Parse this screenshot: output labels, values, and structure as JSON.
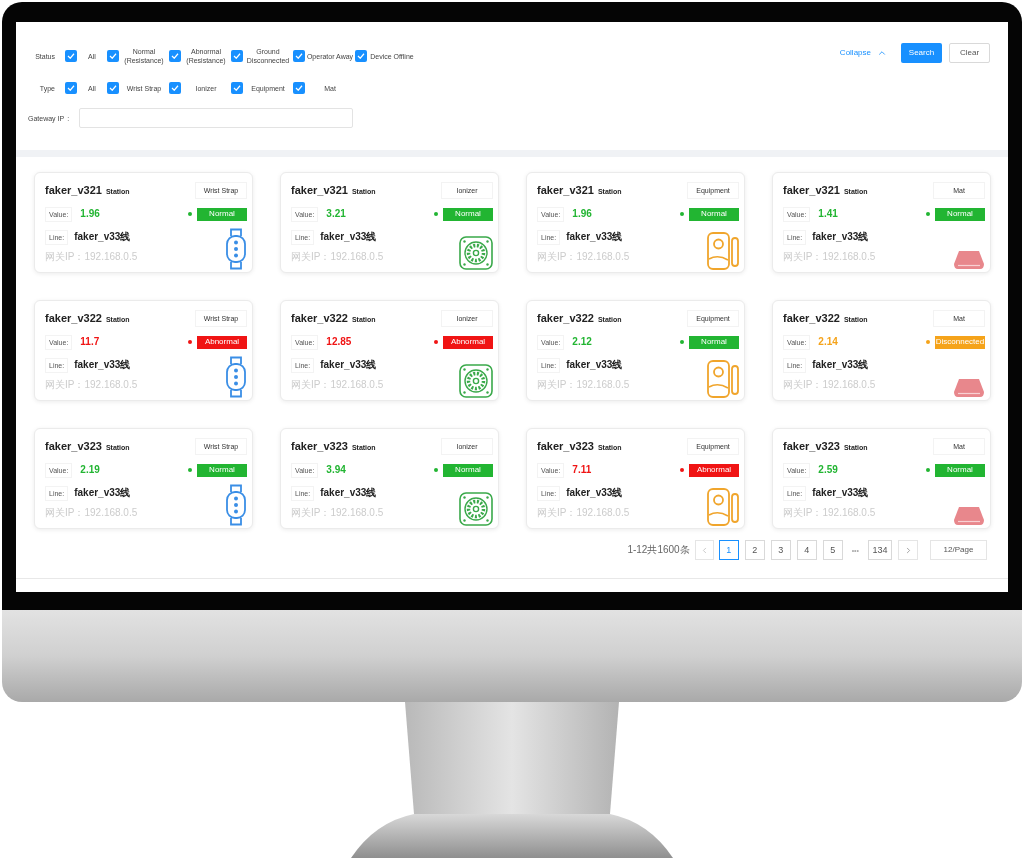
{
  "filters": [
    {
      "label": "Status",
      "options": [
        {
          "label": "All",
          "checked": true
        },
        {
          "label": "Normal (Resistance)",
          "checked": true
        },
        {
          "label": "Abnormal (Resistance)",
          "checked": true
        },
        {
          "label": "Ground Disconnected",
          "checked": true
        },
        {
          "label": "Operator Away",
          "checked": true
        },
        {
          "label": "Device Offline",
          "checked": true
        }
      ]
    },
    {
      "label": "Type",
      "options": [
        {
          "label": "All",
          "checked": true
        },
        {
          "label": "Wrist Strap",
          "checked": true
        },
        {
          "label": "Ionizer",
          "checked": true
        },
        {
          "label": "Equipment",
          "checked": true
        },
        {
          "label": "Mat",
          "checked": true
        }
      ]
    }
  ],
  "gateway_ip": {
    "label": "Gateway IP",
    "separator": ":"
  },
  "collapse": {
    "label": "Collapse"
  },
  "buttons": [
    {
      "label": "Search",
      "kind": "primary"
    },
    {
      "label": "Clear",
      "kind": "default"
    }
  ],
  "cards": [
    {
      "name": "faker_v321",
      "suffix": "Station",
      "device": {
        "label": "Wrist Strap",
        "kind": "wrist_strap"
      },
      "value_label": "Value:",
      "value": "1.96",
      "status": {
        "label": "Normal",
        "color": "#22b532"
      },
      "line_label": "Line:",
      "line": "faker_v33线",
      "gateway_ip": "网关IP：192.168.0.5"
    },
    {
      "name": "faker_v321",
      "suffix": "Station",
      "device": {
        "label": "Ionizer",
        "kind": "ionizer"
      },
      "value_label": "Value:",
      "value": "3.21",
      "status": {
        "label": "Normal",
        "color": "#22b532"
      },
      "line_label": "Line:",
      "line": "faker_v33线",
      "gateway_ip": "网关IP：192.168.0.5"
    },
    {
      "name": "faker_v321",
      "suffix": "Station",
      "device": {
        "label": "Equipment",
        "kind": "equipment"
      },
      "value_label": "Value:",
      "value": "1.96",
      "status": {
        "label": "Normal",
        "color": "#22b532"
      },
      "line_label": "Line:",
      "line": "faker_v33线",
      "gateway_ip": "网关IP：192.168.0.5"
    },
    {
      "name": "faker_v321",
      "suffix": "Station",
      "device": {
        "label": "Mat",
        "kind": "mat"
      },
      "value_label": "Value:",
      "value": "1.41",
      "status": {
        "label": "Normal",
        "color": "#22b532"
      },
      "line_label": "Line:",
      "line": "faker_v33线",
      "gateway_ip": "网关IP：192.168.0.5"
    },
    {
      "name": "faker_v322",
      "suffix": "Station",
      "device": {
        "label": "Wrist Strap",
        "kind": "wrist_strap"
      },
      "value_label": "Value:",
      "value": "11.7",
      "status": {
        "label": "Abnormal",
        "color": "#f01414"
      },
      "line_label": "Line:",
      "line": "faker_v33线",
      "gateway_ip": "网关IP：192.168.0.5"
    },
    {
      "name": "faker_v322",
      "suffix": "Station",
      "device": {
        "label": "Ionizer",
        "kind": "ionizer"
      },
      "value_label": "Value:",
      "value": "12.85",
      "status": {
        "label": "Abnormal",
        "color": "#f01414"
      },
      "line_label": "Line:",
      "line": "faker_v33线",
      "gateway_ip": "网关IP：192.168.0.5"
    },
    {
      "name": "faker_v322",
      "suffix": "Station",
      "device": {
        "label": "Equipment",
        "kind": "equipment"
      },
      "value_label": "Value:",
      "value": "2.12",
      "status": {
        "label": "Normal",
        "color": "#22b532"
      },
      "line_label": "Line:",
      "line": "faker_v33线",
      "gateway_ip": "网关IP：192.168.0.5"
    },
    {
      "name": "faker_v322",
      "suffix": "Station",
      "device": {
        "label": "Mat",
        "kind": "mat"
      },
      "value_label": "Value:",
      "value": "2.14",
      "status": {
        "label": "Disconnected",
        "color": "#f5a31a"
      },
      "line_label": "Line:",
      "line": "faker_v33线",
      "gateway_ip": "网关IP：192.168.0.5"
    },
    {
      "name": "faker_v323",
      "suffix": "Station",
      "device": {
        "label": "Wrist Strap",
        "kind": "wrist_strap"
      },
      "value_label": "Value:",
      "value": "2.19",
      "status": {
        "label": "Normal",
        "color": "#22b532"
      },
      "line_label": "Line:",
      "line": "faker_v33线",
      "gateway_ip": "网关IP：192.168.0.5"
    },
    {
      "name": "faker_v323",
      "suffix": "Station",
      "device": {
        "label": "Ionizer",
        "kind": "ionizer"
      },
      "value_label": "Value:",
      "value": "3.94",
      "status": {
        "label": "Normal",
        "color": "#22b532"
      },
      "line_label": "Line:",
      "line": "faker_v33线",
      "gateway_ip": "网关IP：192.168.0.5"
    },
    {
      "name": "faker_v323",
      "suffix": "Station",
      "device": {
        "label": "Equipment",
        "kind": "equipment"
      },
      "value_label": "Value:",
      "value": "7.11",
      "status": {
        "label": "Abnormal",
        "color": "#f01414"
      },
      "line_label": "Line:",
      "line": "faker_v33线",
      "gateway_ip": "网关IP：192.168.0.5"
    },
    {
      "name": "faker_v323",
      "suffix": "Station",
      "device": {
        "label": "Mat",
        "kind": "mat"
      },
      "value_label": "Value:",
      "value": "2.59",
      "status": {
        "label": "Normal",
        "color": "#22b532"
      },
      "line_label": "Line:",
      "line": "faker_v33线",
      "gateway_ip": "网关IP：192.168.0.5"
    }
  ],
  "pagination": {
    "summary": "1-12共1600条",
    "pages": [
      {
        "label": "1",
        "selected": true
      },
      {
        "label": "2",
        "selected": false
      },
      {
        "label": "3",
        "selected": false
      },
      {
        "label": "4",
        "selected": false
      },
      {
        "label": "5",
        "selected": false
      }
    ],
    "ellipsis": "•••",
    "last_pages": [
      {
        "label": "134",
        "selected": false
      }
    ],
    "page_size": "12/Page"
  }
}
